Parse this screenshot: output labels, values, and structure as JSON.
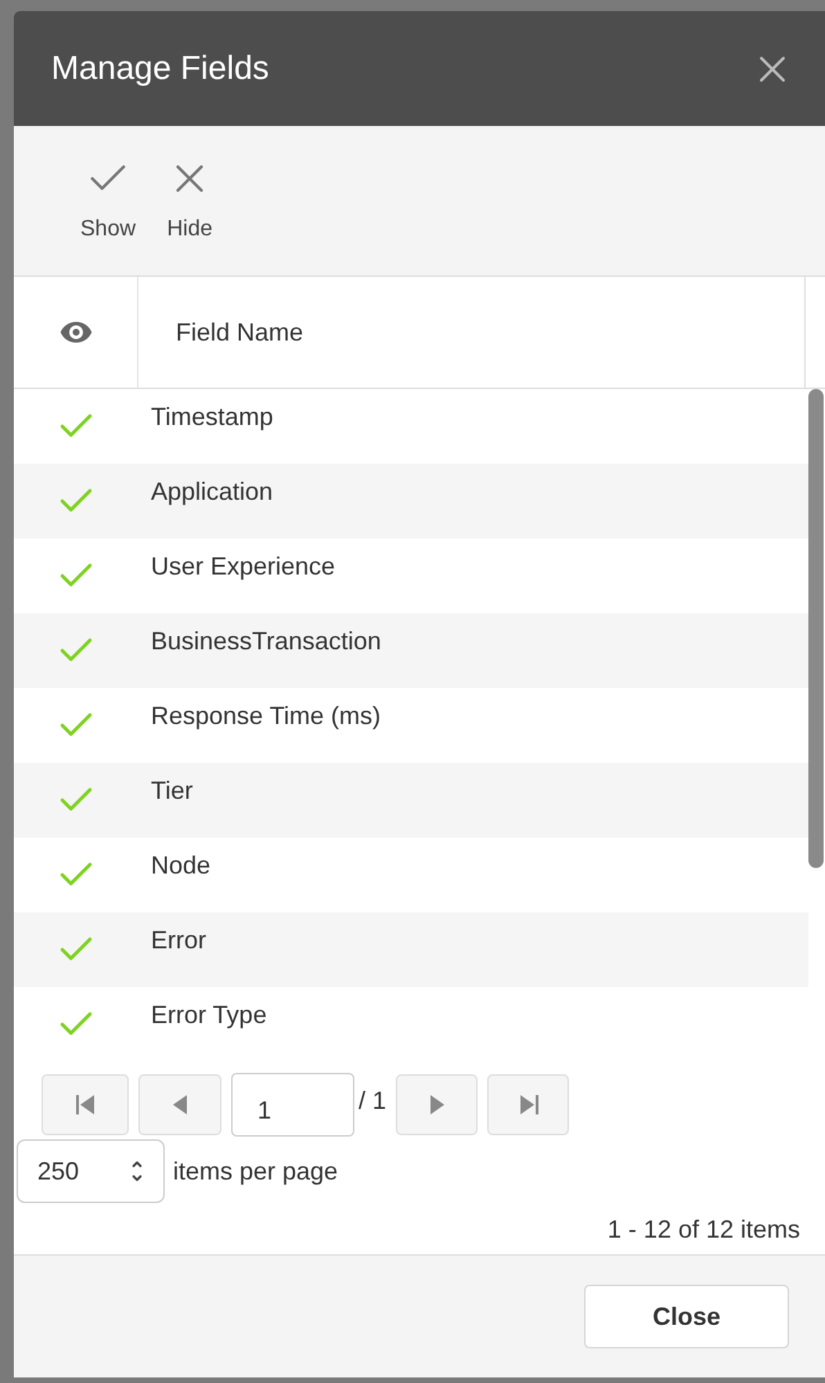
{
  "dialog": {
    "title": "Manage Fields"
  },
  "toolbar": [
    {
      "kind": "show",
      "label": "Show"
    },
    {
      "kind": "hide",
      "label": "Hide"
    }
  ],
  "table": {
    "columns": [
      "Field Name"
    ],
    "rows": [
      {
        "name": "Timestamp",
        "visible": true
      },
      {
        "name": "Application",
        "visible": true
      },
      {
        "name": "User Experience",
        "visible": true
      },
      {
        "name": "BusinessTransaction",
        "visible": true
      },
      {
        "name": "Response Time (ms)",
        "visible": true
      },
      {
        "name": "Tier",
        "visible": true
      },
      {
        "name": "Node",
        "visible": true
      },
      {
        "name": "Error",
        "visible": true
      },
      {
        "name": "Error Type",
        "visible": true
      }
    ]
  },
  "pager": {
    "page": "1",
    "of": "/ 1",
    "page_size": "250",
    "page_size_label": "items per page",
    "summary": "1 - 12 of 12 items"
  },
  "footer": {
    "button": "Close"
  }
}
